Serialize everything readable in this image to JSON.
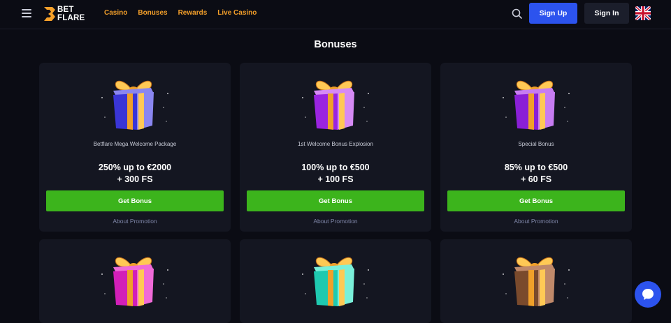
{
  "header": {
    "logo_line1": "BET",
    "logo_line2": "FLARE",
    "nav": [
      {
        "label": "Casino"
      },
      {
        "label": "Bonuses"
      },
      {
        "label": "Rewards"
      },
      {
        "label": "Live Casino"
      }
    ],
    "signup_label": "Sign Up",
    "signin_label": "Sign In",
    "language_flag": "uk-flag-icon"
  },
  "page": {
    "title": "Bonuses"
  },
  "bonuses": [
    {
      "name": "Betflare Mega Welcome Package",
      "offer_line1": "250% up to €2000",
      "offer_line2": "+ 300 FS",
      "button": "Get Bonus",
      "about": "About Promotion",
      "gift_color": "#3a35d6",
      "gift_color_light": "#8a86f0"
    },
    {
      "name": "1st Welcome Bonus Explosion",
      "offer_line1": "100% up to €500",
      "offer_line2": "+ 100 FS",
      "button": "Get Bonus",
      "about": "About Promotion",
      "gift_color": "#9a24e0",
      "gift_color_light": "#d68af5"
    },
    {
      "name": "Special Bonus",
      "offer_line1": "85% up to €500",
      "offer_line2": "+ 60 FS",
      "button": "Get Bonus",
      "about": "About Promotion",
      "gift_color": "#8a1fd6",
      "gift_color_light": "#c77cf2"
    },
    {
      "gift_color": "#d21fb8",
      "gift_color_light": "#f06ad8"
    },
    {
      "gift_color": "#1fc9b0",
      "gift_color_light": "#7af0da"
    },
    {
      "gift_color": "#7a4a2c",
      "gift_color_light": "#c0896a"
    }
  ],
  "colors": {
    "accent_nav": "#f5a02a",
    "signup_bg": "#2c53ee",
    "cta_green": "#3cb41c",
    "card_bg": "#141621",
    "page_bg": "#0b0c14"
  },
  "chat_icon": "chat-bubble-icon"
}
